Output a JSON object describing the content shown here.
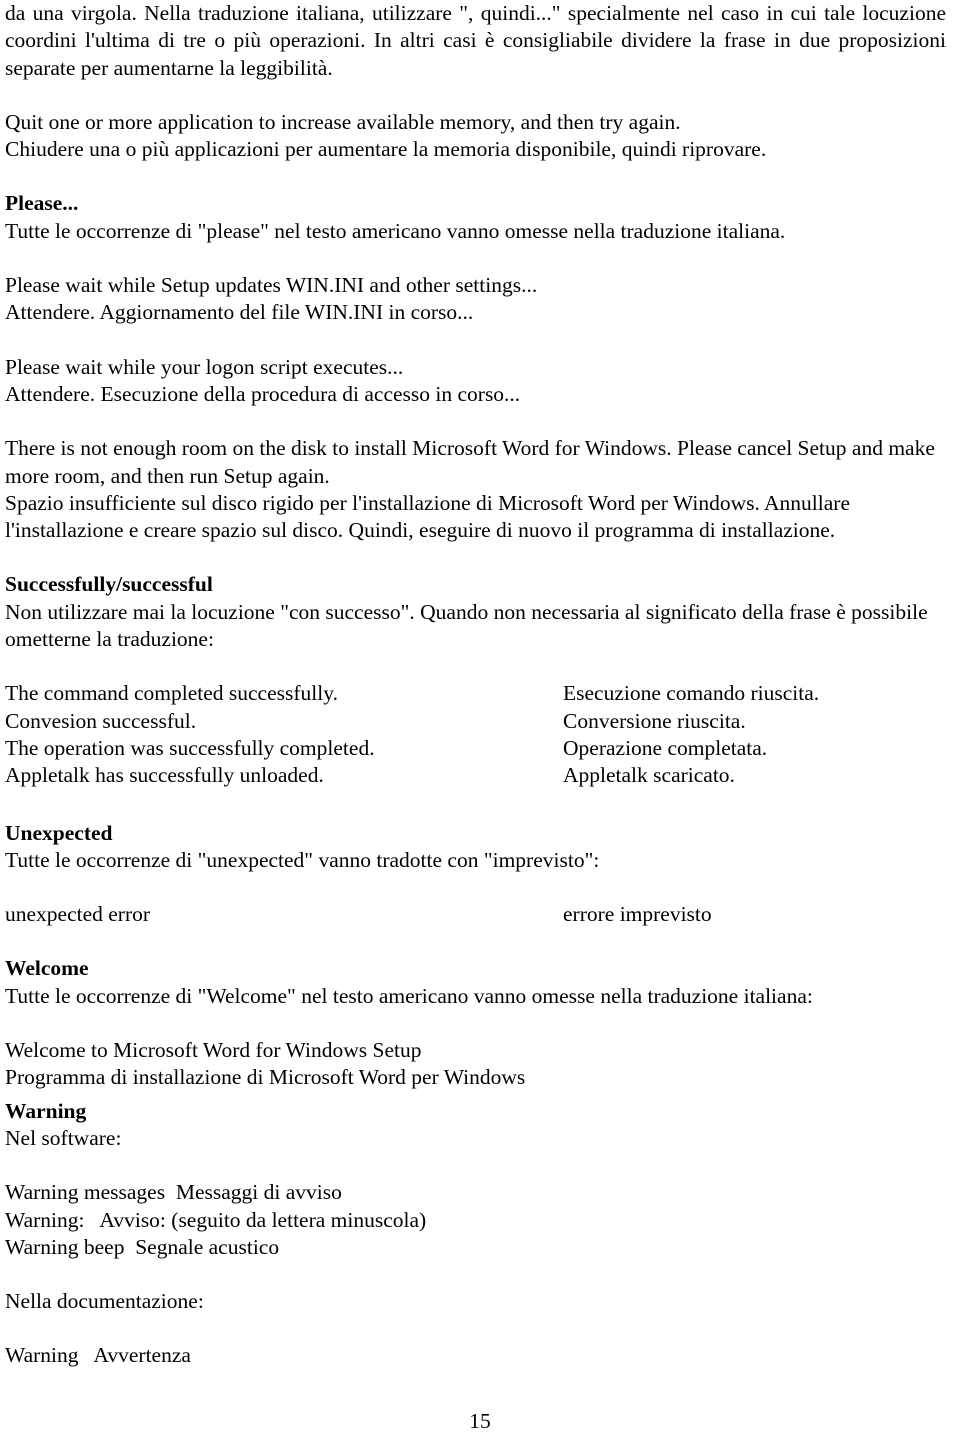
{
  "document": {
    "page_number": "15",
    "blocks": {
      "intro_paragraph": [
        "da una virgola. Nella traduzione italiana, utilizzare \", quindi...\" specialmente nel caso in cui tale locuzione coordini l'ultima di tre o più operazioni. In altri casi è consigliabile dividere la frase in due proposizioni separate per aumentarne la leggibilità."
      ],
      "quit_example": {
        "english": "Quit one or more application to increase available memory, and then try again.",
        "italian": "Chiudere una o più applicazioni per aumentare la memoria disponibile, quindi riprovare."
      },
      "please": {
        "heading": "Please...",
        "rule": "Tutte le occorrenze di \"please\" nel testo americano vanno omesse nella traduzione italiana.",
        "examples": [
          {
            "english": "Please wait while Setup updates WIN.INI and other settings...",
            "italian": "Attendere. Aggiornamento del file WIN.INI in corso..."
          },
          {
            "english": "Please wait while your logon script executes...",
            "italian": "Attendere. Esecuzione della procedura di accesso in corso..."
          }
        ],
        "long_example": {
          "english": "There is not enough room on the disk to install Microsoft Word for Windows. Please cancel Setup and make more room, and then run Setup again.",
          "italian": "Spazio insufficiente sul disco rigido per l'installazione di Microsoft Word per Windows. Annullare l'installazione e creare spazio sul disco. Quindi, eseguire di nuovo il programma di installazione."
        }
      },
      "successfully": {
        "heading": "Successfully/successful",
        "rule": "Non utilizzare mai la locuzione \"con successo\". Quando non necessaria al significato della frase è possibile ometterne la traduzione:",
        "pairs": [
          {
            "english": "The command completed successfully.",
            "italian": "Esecuzione comando riuscita."
          },
          {
            "english": "Convesion successful.",
            "italian": "Conversione riuscita."
          },
          {
            "english": "The operation was successfully completed.",
            "italian": "Operazione completata."
          },
          {
            "english": "Appletalk has successfully unloaded.",
            "italian": "Appletalk scaricato."
          }
        ]
      },
      "unexpected": {
        "heading": "Unexpected",
        "rule": "Tutte le occorrenze di \"unexpected\" vanno tradotte con \"imprevisto\":",
        "pairs": [
          {
            "english": "unexpected error",
            "italian": "errore imprevisto"
          }
        ]
      },
      "welcome": {
        "heading": "Welcome",
        "rule": "Tutte le occorrenze di \"Welcome\" nel testo americano vanno omesse nella traduzione italiana:",
        "example": {
          "english": "Welcome to Microsoft Word for Windows Setup",
          "italian": "Programma di installazione di Microsoft Word per Windows"
        }
      },
      "warning": {
        "heading": "Warning",
        "software_label": "Nel software:",
        "software_lines": [
          "Warning messages  Messaggi di avviso",
          "Warning:   Avviso: (seguito da lettera minuscola)",
          "Warning beep  Segnale acustico"
        ],
        "documentation_label": "Nella documentazione:",
        "documentation_lines": [
          "Warning   Avvertenza"
        ]
      }
    }
  }
}
